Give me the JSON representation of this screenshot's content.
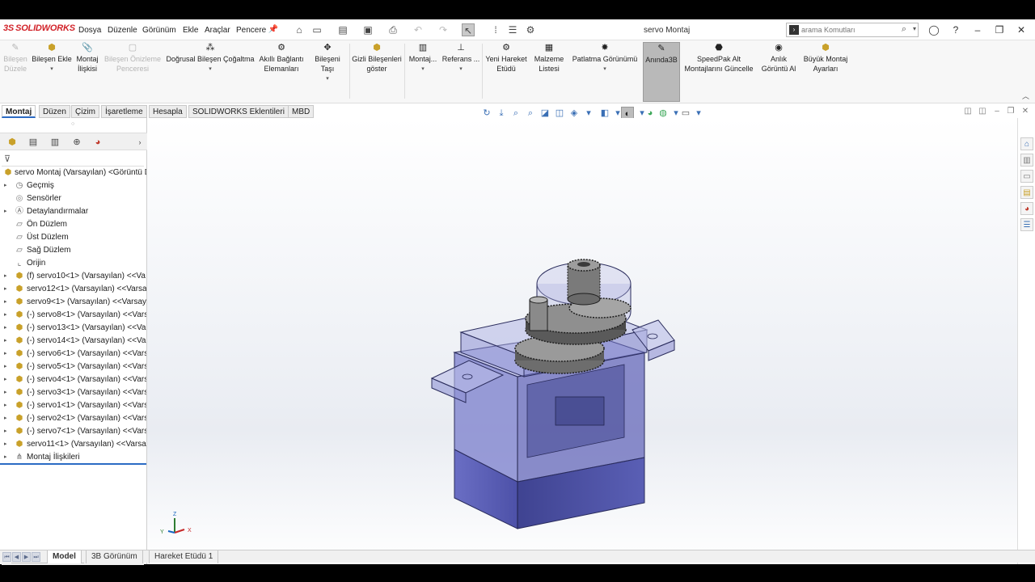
{
  "titlebar": {
    "logo_text": "SOLIDWORKS",
    "logo_mark": "3S",
    "menus": [
      "Dosya",
      "Düzenle",
      "Görünüm",
      "Ekle",
      "Araçlar",
      "Pencere"
    ],
    "document_title": "servo Montaj",
    "search_placeholder": "arama Komutları"
  },
  "commands": {
    "bilesen_duzenle": [
      "Bileşen",
      "Düzele"
    ],
    "bilesen_ekle": "Bileşen Ekle",
    "montaj_iliskisi": [
      "Montaj",
      "İlişkisi"
    ],
    "bilesen_onizleme": [
      "Bileşen Önizleme",
      "Penceresi"
    ],
    "dogrusal_cogaltma": "Doğrusal Bileşen Çoğaltma",
    "akilli_baglanti": [
      "Akıllı Bağlantı",
      "Elemanları"
    ],
    "bileseni_tasi": "Bileşeni Taşı",
    "gizli_bilesenler": [
      "Gizli Bileşenleri",
      "göster"
    ],
    "montaj": "Montaj...",
    "referans": "Referans ...",
    "yeni_hareket": [
      "Yeni Hareket",
      "Etüdü"
    ],
    "malzeme_listesi": [
      "Malzeme",
      "Listesi"
    ],
    "patlatma": "Patlatma Görünümü",
    "aninda3b": "Anında3B",
    "speedpak": [
      "SpeedPak Alt",
      "Montajlarını Güncelle"
    ],
    "anlik_goruntu": [
      "Anlık",
      "Görüntü Al"
    ],
    "buyuk_montaj": [
      "Büyük Montaj",
      "Ayarları"
    ]
  },
  "tabs": [
    "Montaj",
    "Düzen",
    "Çizim",
    "İşaretleme",
    "Hesapla",
    "SOLIDWORKS Eklentileri",
    "MBD"
  ],
  "tree": {
    "root": "servo Montaj  (Varsayılan) <Görüntü D",
    "items": [
      "Geçmiş",
      "Sensörler",
      "Detaylandırmalar",
      "Ön Düzlem",
      "Üst Düzlem",
      "Sağ Düzlem",
      "Orijin",
      "(f) servo10<1> (Varsayılan) <<Va",
      "servo12<1> (Varsayılan) <<Varsa",
      "servo9<1> (Varsayılan) <<Varsay",
      "(-) servo8<1> (Varsayılan) <<Vars",
      "(-) servo13<1> (Varsayılan) <<Va",
      "(-) servo14<1> (Varsayılan) <<Va",
      "(-) servo6<1> (Varsayılan) <<Vars",
      "(-) servo5<1> (Varsayılan) <<Vars",
      "(-) servo4<1> (Varsayılan) <<Vars",
      "(-) servo3<1> (Varsayılan) <<Vars",
      "(-) servo1<1> (Varsayılan) <<Vars",
      "(-) servo2<1> (Varsayılan) <<Vars",
      "(-) servo7<1> (Varsayılan) <<Vars",
      "servo11<1> (Varsayılan) <<Varsa",
      "Montaj İlişkileri"
    ]
  },
  "triad": {
    "x": "X",
    "y": "Y",
    "z": "Z"
  },
  "bottom_tabs": [
    "Model",
    "3B Görünüm",
    "Hareket Etüdü 1"
  ],
  "colors": {
    "accent": "#2b6bc4",
    "servo_body": "#5a5fb5",
    "logo": "#d2232a"
  }
}
